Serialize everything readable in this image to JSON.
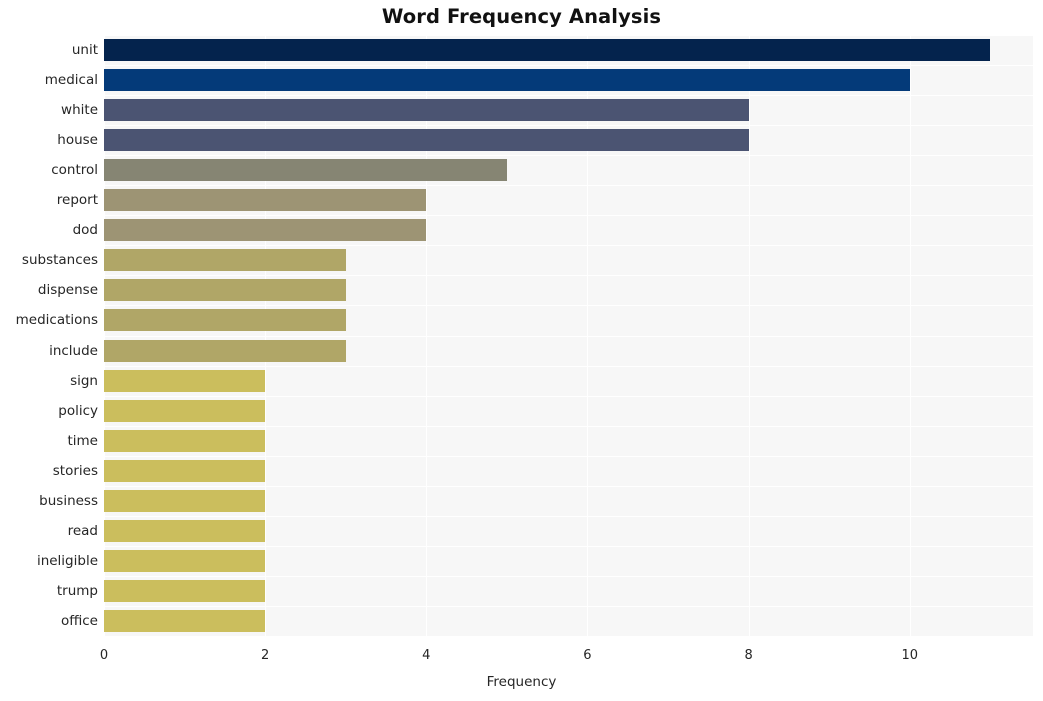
{
  "chart_data": {
    "type": "bar",
    "orientation": "horizontal",
    "title": "Word Frequency Analysis",
    "xlabel": "Frequency",
    "ylabel": "",
    "categories": [
      "unit",
      "medical",
      "white",
      "house",
      "control",
      "report",
      "dod",
      "substances",
      "dispense",
      "medications",
      "include",
      "sign",
      "policy",
      "time",
      "stories",
      "business",
      "read",
      "ineligible",
      "trump",
      "office"
    ],
    "values": [
      11,
      10,
      8,
      8,
      5,
      4,
      4,
      3,
      3,
      3,
      3,
      2,
      2,
      2,
      2,
      2,
      2,
      2,
      2,
      2
    ],
    "bar_colors": [
      "#04234d",
      "#043a79",
      "#4b5472",
      "#4b5472",
      "#868573",
      "#9d9474",
      "#9d9474",
      "#b0a667",
      "#b0a667",
      "#b0a667",
      "#b0a667",
      "#cbbe5d",
      "#cbbe5d",
      "#cbbe5d",
      "#cbbe5d",
      "#cbbe5d",
      "#cbbe5d",
      "#cbbe5d",
      "#cbbe5d",
      "#cbbe5d"
    ],
    "xticks": [
      0,
      2,
      4,
      6,
      8,
      10
    ],
    "xtick_labels": [
      "0",
      "2",
      "4",
      "6",
      "8",
      "10"
    ],
    "xlim": [
      0,
      11.53
    ],
    "grid": true,
    "grid_color": "#ffffff",
    "plot_background": "#f7f7f7",
    "figure_background": "#ffffff",
    "legend": null,
    "title_color": "#111111",
    "tick_color": "#262626"
  }
}
